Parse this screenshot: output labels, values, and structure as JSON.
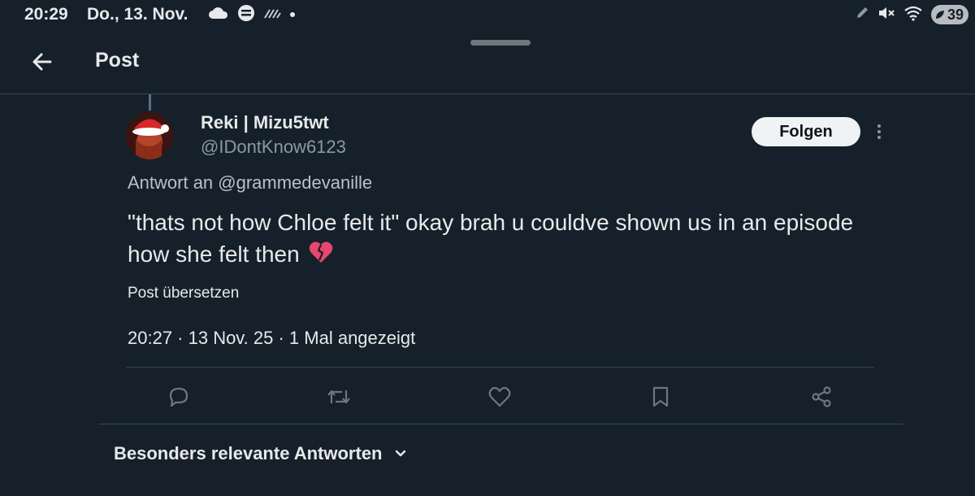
{
  "status_bar": {
    "time": "20:29",
    "date": "Do., 13. Nov.",
    "battery": "39",
    "icons": [
      "cloud-icon",
      "app-icon",
      "signal-lines-icon",
      "dot-icon",
      "pen-icon",
      "mute-icon",
      "wifi-icon",
      "battery-leaf-icon"
    ]
  },
  "header": {
    "title": "Post",
    "back_icon": "arrow-left-icon"
  },
  "post": {
    "author_name": "Reki | Mizu5twt",
    "author_handle": "@IDontKnow6123",
    "follow_label": "Folgen",
    "reply_to": "Antwort an @grammedevanille",
    "text": "\"thats not how Chloe felt it\" okay brah u couldve shown us in an episode how she felt then",
    "emoji": "broken-heart",
    "translate_label": "Post übersetzen",
    "meta": "20:27 · 13 Nov. 25 · 1 Mal angezeigt",
    "actions": [
      "reply-icon",
      "repost-icon",
      "like-icon",
      "bookmark-icon",
      "share-icon"
    ]
  },
  "replies": {
    "sort_label": "Besonders relevante Antworten"
  },
  "colors": {
    "background": "#15202b",
    "text": "#e7e9ea",
    "secondary": "#8b98a5",
    "divider": "#38444d",
    "follow_bg": "#eff3f4"
  }
}
